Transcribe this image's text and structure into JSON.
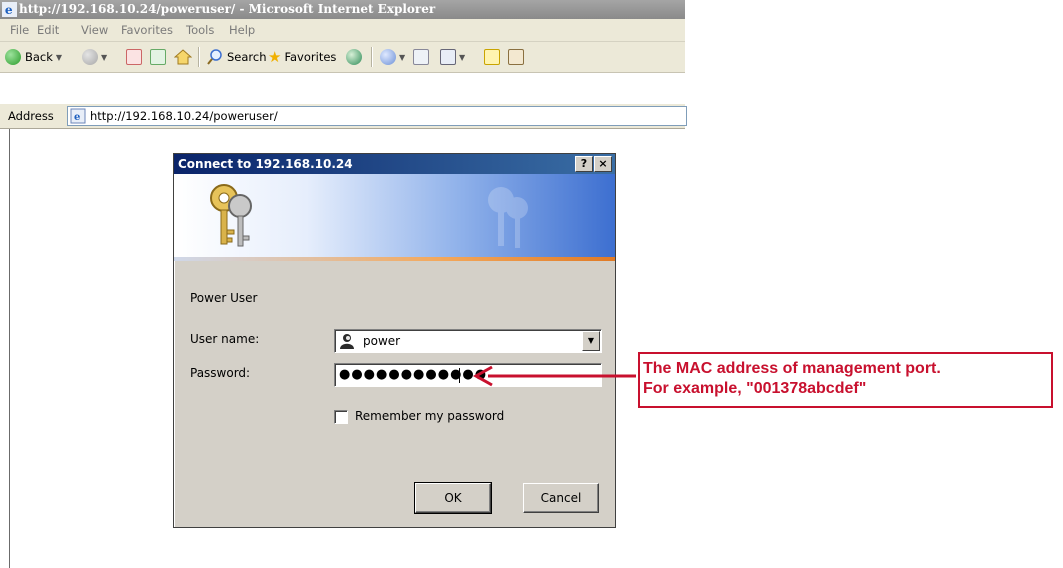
{
  "window": {
    "title": "http://192.168.10.24/poweruser/ - Microsoft Internet Explorer"
  },
  "menu": [
    "File",
    "Edit",
    "View",
    "Favorites",
    "Tools",
    "Help"
  ],
  "toolbar": {
    "back_label": "Back",
    "search_label": "Search",
    "favorites_label": "Favorites"
  },
  "address": {
    "label": "Address",
    "url": "http://192.168.10.24/poweruser/"
  },
  "dialog": {
    "title": "Connect to 192.168.10.24",
    "help_button": "?",
    "close_button": "×",
    "realm": "Power User",
    "username_label": "User name:",
    "username_value": "power",
    "password_label": "Password:",
    "password_value": "●●●●●●●●●●●●",
    "remember_label": "Remember my password",
    "ok_label": "OK",
    "cancel_label": "Cancel"
  },
  "annotation": {
    "line1": "The MAC address of management port.",
    "line2": "For example, \"001378abcdef\"",
    "color": "#c8102e"
  }
}
